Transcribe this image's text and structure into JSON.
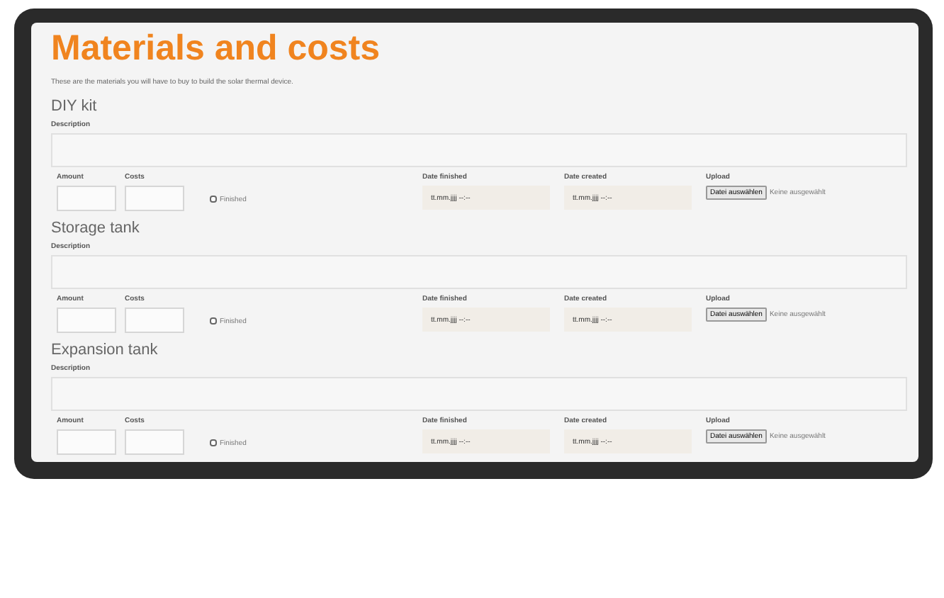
{
  "title": "Materials and costs",
  "intro": "These are the materials you will have to buy to build the solar thermal device.",
  "sections": [
    {
      "heading": "DIY kit",
      "description_label": "Description",
      "amount_label": "Amount",
      "costs_label": "Costs",
      "finished": {
        "label": "Finished",
        "checked": false
      },
      "date_finished": {
        "label": "Date finished",
        "placeholder": "tt.mm.jjjj --:--"
      },
      "date_created": {
        "label": "Date created",
        "placeholder": "tt.mm.jjjj --:--"
      },
      "upload": {
        "label": "Upload",
        "button": "Datei auswählen",
        "status": "Keine ausgewählt"
      }
    },
    {
      "heading": "Storage tank",
      "description_label": "Description",
      "amount_label": "Amount",
      "costs_label": "Costs",
      "finished": {
        "label": "Finished",
        "checked": false
      },
      "date_finished": {
        "label": "Date finished",
        "placeholder": "tt.mm.jjjj --:--"
      },
      "date_created": {
        "label": "Date created",
        "placeholder": "tt.mm.jjjj --:--"
      },
      "upload": {
        "label": "Upload",
        "button": "Datei auswählen",
        "status": "Keine ausgewählt"
      }
    },
    {
      "heading": "Expansion tank",
      "description_label": "Description",
      "amount_label": "Amount",
      "costs_label": "Costs",
      "finished": {
        "label": "Finished",
        "checked": false
      },
      "date_finished": {
        "label": "Date finished",
        "placeholder": "tt.mm.jjjj --:--"
      },
      "date_created": {
        "label": "Date created",
        "placeholder": "tt.mm.jjjj --:--"
      },
      "upload": {
        "label": "Upload",
        "button": "Datei auswählen",
        "status": "Keine ausgewählt"
      }
    }
  ]
}
